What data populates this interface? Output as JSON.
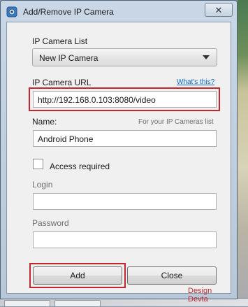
{
  "window": {
    "title": "Add/Remove IP Camera",
    "close_label": "✕"
  },
  "camera_list": {
    "label": "IP Camera List",
    "selected": "New IP Camera"
  },
  "camera_url": {
    "label": "IP Camera URL",
    "help_link": "What's this?",
    "value": "http://192.168.0.103:8080/video"
  },
  "name": {
    "label": "Name:",
    "hint": "For your IP Cameras list",
    "value": "Android Phone"
  },
  "access": {
    "label": "Access required",
    "checked": false
  },
  "login": {
    "label": "Login",
    "value": ""
  },
  "password": {
    "label": "Password",
    "value": ""
  },
  "buttons": {
    "add": "Add",
    "close": "Close"
  },
  "credit": "Design Devta",
  "colors": {
    "highlight": "#c1272d",
    "link": "#0b66c3"
  }
}
